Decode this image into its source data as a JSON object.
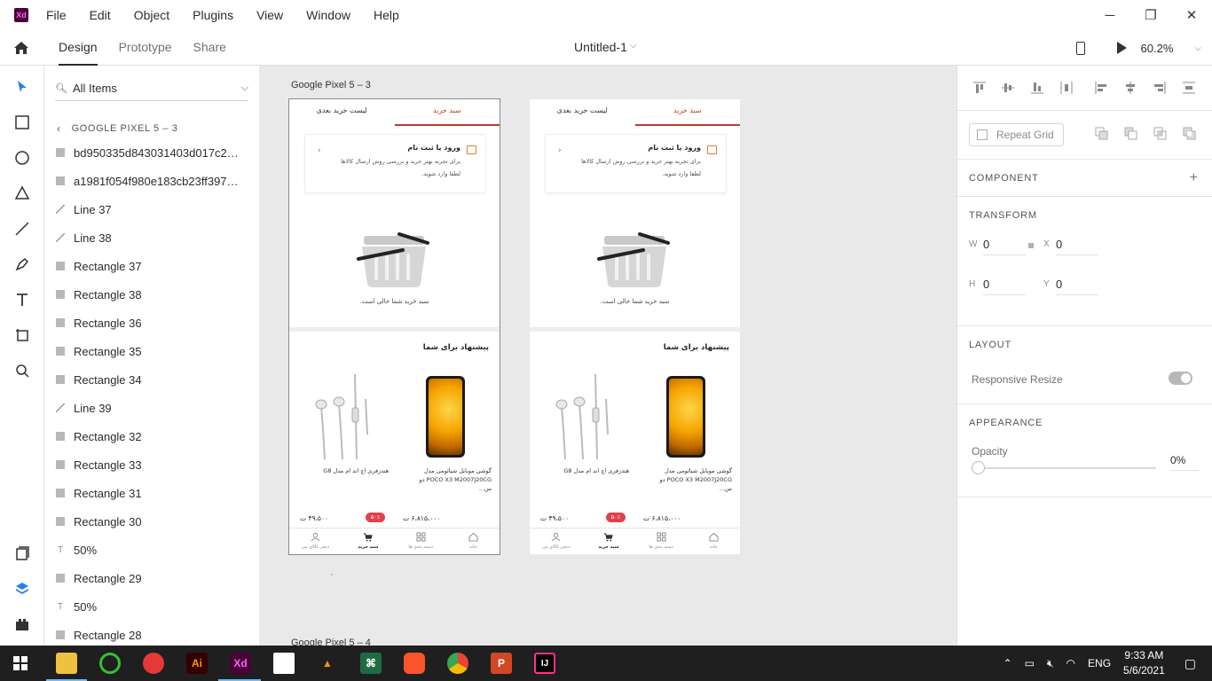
{
  "titlebar": {
    "app_logo": "Xd",
    "menu": [
      "File",
      "Edit",
      "Object",
      "Plugins",
      "View",
      "Window",
      "Help"
    ],
    "minimize": "─",
    "restore": "❐",
    "close": "✕"
  },
  "toolbar": {
    "tabs": [
      "Design",
      "Prototype",
      "Share"
    ],
    "active_tab": "Design",
    "document_title": "Untitled-1",
    "zoom": "60.2%"
  },
  "layers": {
    "filter_label": "All Items",
    "breadcrumb": "GOOGLE PIXEL 5 – 3",
    "items": [
      {
        "icon": "image",
        "name": "bd950335d843031403d017c22..."
      },
      {
        "icon": "image",
        "name": "a1981f054f980e183cb23ff3979..."
      },
      {
        "icon": "line",
        "name": "Line 37"
      },
      {
        "icon": "line",
        "name": "Line 38"
      },
      {
        "icon": "rect",
        "name": "Rectangle 37"
      },
      {
        "icon": "rect",
        "name": "Rectangle 38"
      },
      {
        "icon": "rect",
        "name": "Rectangle 36"
      },
      {
        "icon": "rect",
        "name": "Rectangle 35"
      },
      {
        "icon": "rect",
        "name": "Rectangle 34"
      },
      {
        "icon": "line",
        "name": "Line 39"
      },
      {
        "icon": "rect",
        "name": "Rectangle 32"
      },
      {
        "icon": "rect",
        "name": "Rectangle 33"
      },
      {
        "icon": "rect",
        "name": "Rectangle 31"
      },
      {
        "icon": "rect",
        "name": "Rectangle 30"
      },
      {
        "icon": "text",
        "name": "50%"
      },
      {
        "icon": "rect",
        "name": "Rectangle 29"
      },
      {
        "icon": "text",
        "name": "50%"
      },
      {
        "icon": "rect",
        "name": "Rectangle 28"
      }
    ]
  },
  "canvas": {
    "artboard1_label": "Google Pixel 5 – 3",
    "artboard2_label": "Google Pixel 5 – 4",
    "stray_mark": "-",
    "screen": {
      "tab_cart": "سبد خرید",
      "tab_later": "لیست خرید بعدی",
      "login_title": "ورود یا ثبت نام",
      "login_desc": "برای تجربه بهتر خرید  و  بررسی روش ارسال کالاها لطفا وارد شوید.",
      "empty_text": "سبد خرید شما خالی است.",
      "suggest_title": "پیشنهاد برای شما",
      "product1_name": "گوشی موبایل شیائومی مدل POCO X3 M2007J20CG دو س...",
      "product2_name": "هندزفری اچ اند ام مدل G8",
      "product1_price": "۶،۸۱۵،۰۰۰ ت",
      "product2_price": "۴۹،۵۰۰ ت",
      "discount": "۵۰٪",
      "nav": [
        "خانه",
        "دسته بندی ها",
        "سبد خرید",
        "دیجی کالای من"
      ]
    }
  },
  "props": {
    "repeat_grid": "Repeat Grid",
    "component_title": "COMPONENT",
    "transform_title": "TRANSFORM",
    "w_label": "W",
    "w_value": "0",
    "x_label": "X",
    "x_value": "0",
    "h_label": "H",
    "h_value": "0",
    "y_label": "Y",
    "y_value": "0",
    "layout_title": "LAYOUT",
    "responsive_resize": "Responsive Resize",
    "responsive_resize_on": true,
    "appearance_title": "APPEARANCE",
    "opacity_label": "Opacity",
    "opacity_value": "0%"
  },
  "taskbar": {
    "language": "ENG",
    "time": "9:33 AM",
    "date": "5/6/2021"
  },
  "colors": {
    "accent_red": "#c0392b",
    "badge_red": "#e0424b",
    "xd_brand": "#470137"
  }
}
